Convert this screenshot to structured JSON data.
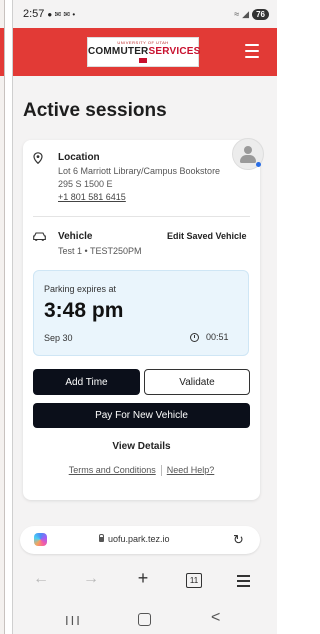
{
  "status_bar": {
    "time": "2:57",
    "indicators": "● ✉ ✉ •",
    "battery": "76"
  },
  "header": {
    "logo_small": "UNIVERSITY OF UTAH",
    "logo_text_a": "COMMUTER",
    "logo_text_b": "SERVICES",
    "brand_color": "#e23a36"
  },
  "page": {
    "title": "Active sessions"
  },
  "session": {
    "location_label": "Location",
    "location_name": "Lot 6 Marriott Library/Campus Bookstore",
    "address": "295 S 1500 E",
    "phone": "+1 801 581 6415",
    "vehicle_label": "Vehicle",
    "vehicle_detail": "Test 1 • TEST250PM",
    "edit_vehicle": "Edit Saved Vehicle",
    "expires_label": "Parking expires at",
    "expires_time": "3:48 pm",
    "expires_date": "Sep 30",
    "countdown": "00:51"
  },
  "actions": {
    "add_time": "Add Time",
    "validate": "Validate",
    "pay_new": "Pay For New Vehicle",
    "view_details": "View Details",
    "terms": "Terms and Conditions",
    "help": "Need Help?"
  },
  "browser": {
    "url": "uofu.park.tez.io",
    "tab_count": "11",
    "back": "←",
    "forward": "→",
    "new_tab": "+",
    "reload": "↻"
  },
  "system_nav": {
    "recents": "III",
    "back": "<"
  }
}
